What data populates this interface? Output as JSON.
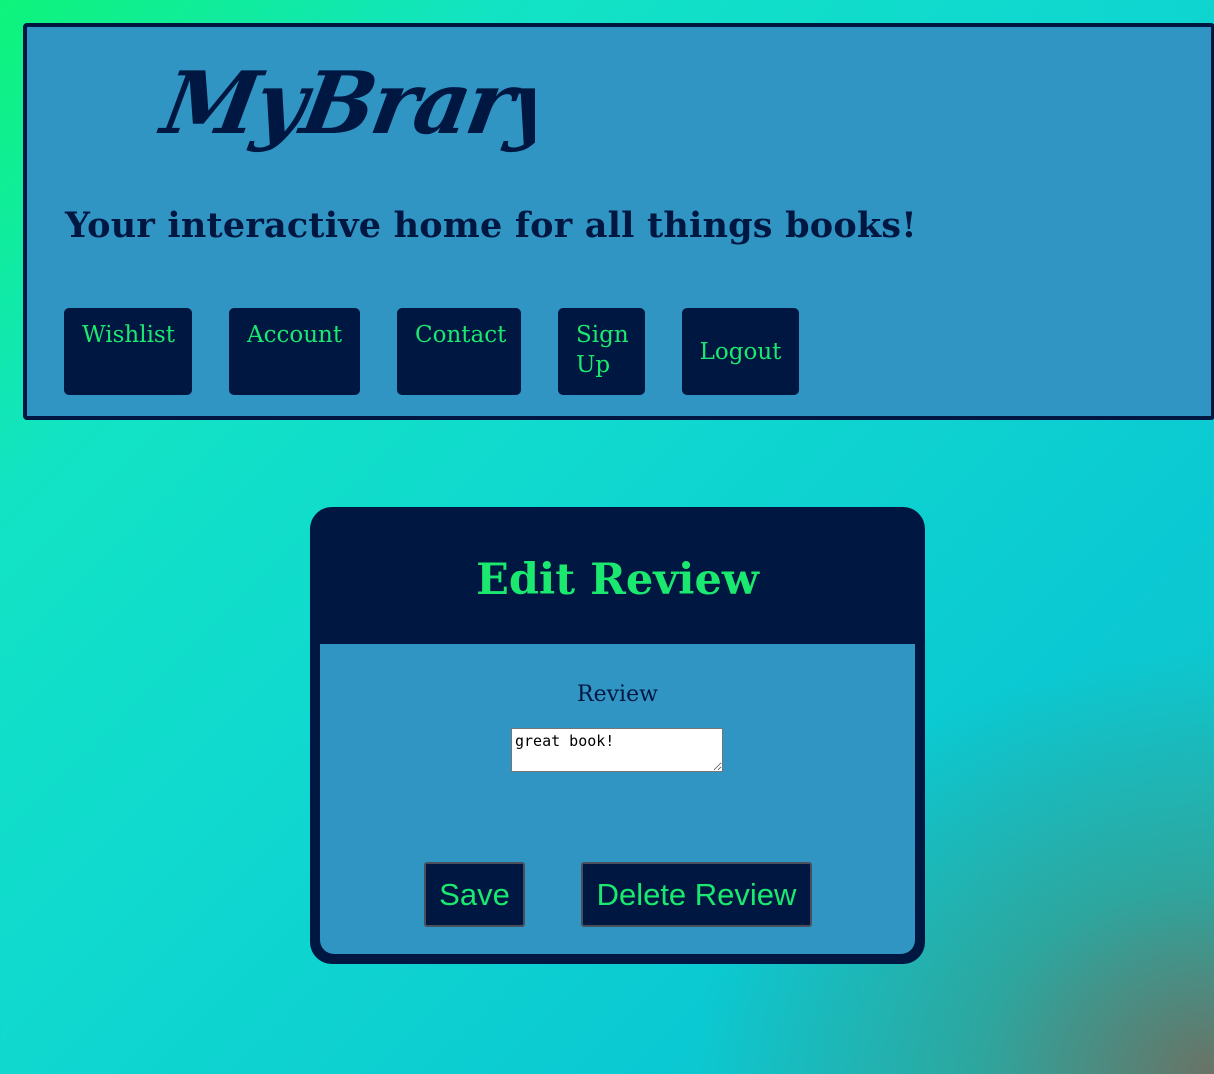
{
  "header": {
    "logo_text": "MyBrary",
    "tagline": "Your interactive home for all things books!",
    "nav": [
      {
        "label": "Wishlist"
      },
      {
        "label": "Account"
      },
      {
        "label": "Contact"
      },
      {
        "label": "Sign Up"
      },
      {
        "label": "Logout"
      }
    ]
  },
  "edit_review": {
    "title": "Edit Review",
    "field_label": "Review",
    "review_value": "great book!",
    "save_label": "Save",
    "delete_label": "Delete Review"
  },
  "colors": {
    "primary_dark": "#001742",
    "panel_blue": "#3195c4",
    "accent_green": "#1be86f"
  }
}
